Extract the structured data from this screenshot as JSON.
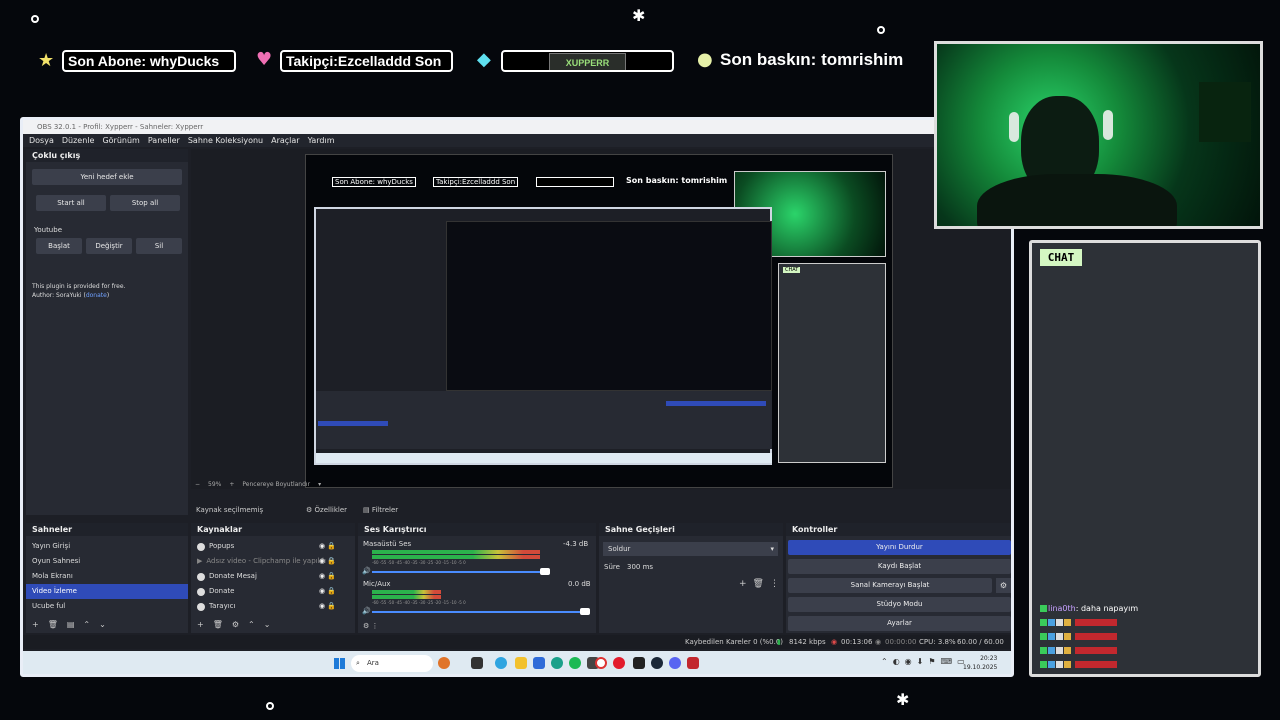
{
  "banner": {
    "last_sub": "Son Abone: whyDucks",
    "last_follower": "Takipçi:Ezcelladdd   Son",
    "logo_text": "XUPPERR",
    "last_raid": "Son baskın: tomrishim"
  },
  "obs": {
    "title": "OBS 32.0.1 - Profil: Xypperr - Sahneler: Xypperr",
    "menu": [
      "Dosya",
      "Düzenle",
      "Görünüm",
      "Paneller",
      "Sahne Koleksiyonu",
      "Araçlar",
      "Yardım"
    ],
    "multistream": {
      "title": "Çoklu çıkış",
      "new_target": "Yeni hedef ekle",
      "start_all": "Start all",
      "stop_all": "Stop all",
      "youtube": "Youtube",
      "start": "Başlat",
      "change": "Değiştir",
      "delete": "Sil",
      "note1": "This plugin is provided for free.",
      "note2": "Author: SoraYuki (",
      "note_link": "donate",
      "note3": ")"
    },
    "zoom_label": "59%",
    "fit_label": "Pencereye Boyutlandır",
    "no_source": "Kaynak seçilmemiş",
    "properties": "Özellikler",
    "filters": "Filtreler",
    "scenes": {
      "title": "Sahneler",
      "items": [
        "Yayın Girişi",
        "Oyun Sahnesi",
        "Mola Ekranı",
        "Video İzleme",
        "Ucube ful"
      ],
      "selected": 3
    },
    "sources": {
      "title": "Kaynaklar",
      "items": [
        "Popups",
        "Adsız video - Clipchamp ile yapıldı (1",
        "Donate Mesaj",
        "Donate",
        "Tarayıcı"
      ]
    },
    "mixer": {
      "title": "Ses Karıştırıcı",
      "ch1_name": "Masaüstü Ses",
      "ch1_db": "-4.3 dB",
      "ch1_level": 0.78,
      "ch2_name": "Mic/Aux",
      "ch2_db": "0.0 dB",
      "ch2_level": 0.32,
      "scale": "-60 -55 -50 -45 -40 -35 -30 -25 -20 -15 -10 -5 0"
    },
    "transitions": {
      "title": "Sahne Geçişleri",
      "type": "Soldur",
      "duration_label": "Süre",
      "duration": "300 ms"
    },
    "controls": {
      "title": "Kontroller",
      "stop_stream": "Yayını Durdur",
      "start_record": "Kaydı Başlat",
      "virtual_cam": "Sanal Kamerayı Başlat",
      "studio": "Stüdyo Modu",
      "settings": "Ayarlar"
    },
    "status": {
      "dropped": "Kaybedilen Kareler 0 (%0.0)",
      "bitrate": "8142 kbps",
      "stream_time": "00:13:06",
      "rec_time": "00:00:00",
      "cpu": "CPU: 3.8%",
      "fps": "60.00 / 60.00 FPS"
    },
    "taskbar": {
      "search": "Ara",
      "time": "20:23",
      "date": "19.10.2025"
    }
  },
  "preview": {
    "last_sub": "Son Abone: whyDucks",
    "last_follower": "Takipçi:Ezcelladdd   Son",
    "last_raid": "Son baskın: tomrishim",
    "chat_label": "CHAT"
  },
  "chat": {
    "header": "CHAT",
    "first_user": "lina0th",
    "first_msg": ": daha napayım"
  },
  "colors": {
    "accent_blue": "#2f4bb8",
    "webcam_green": "#2bd46a",
    "chat_header": "#d4f7c2"
  }
}
